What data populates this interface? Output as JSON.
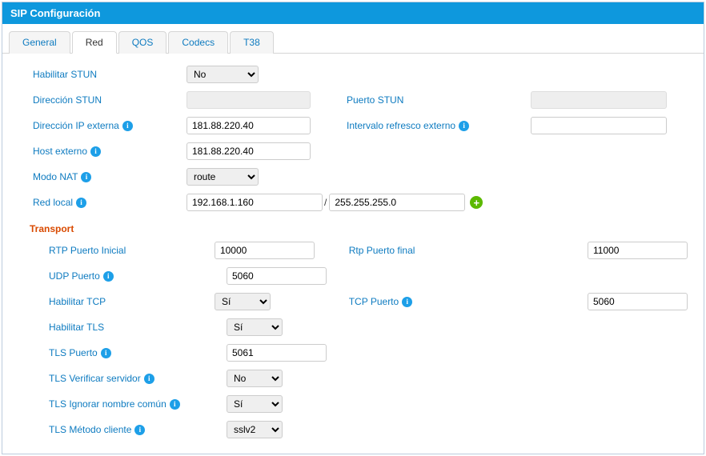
{
  "panel": {
    "title": "SIP Configuración"
  },
  "tabs": {
    "general": "General",
    "red": "Red",
    "qos": "QOS",
    "codecs": "Codecs",
    "t38": "T38",
    "active": "red"
  },
  "labels": {
    "habilitar_stun": "Habilitar STUN",
    "direccion_stun": "Dirección STUN",
    "puerto_stun": "Puerto STUN",
    "direccion_ip_externa": "Dirección IP externa",
    "intervalo_refresco_externo": "Intervalo refresco externo",
    "host_externo": "Host externo",
    "modo_nat": "Modo NAT",
    "red_local": "Red local",
    "transport": "Transport",
    "rtp_puerto_inicial": "RTP Puerto Inicial",
    "rtp_puerto_final": "Rtp Puerto final",
    "udp_puerto": "UDP Puerto",
    "habilitar_tcp": "Habilitar TCP",
    "tcp_puerto": "TCP Puerto",
    "habilitar_tls": "Habilitar TLS",
    "tls_puerto": "TLS Puerto",
    "tls_verificar_servidor": "TLS Verificar servidor",
    "tls_ignorar_nombre_comun": "TLS Ignorar nombre común",
    "tls_metodo_cliente": "TLS Método cliente"
  },
  "values": {
    "habilitar_stun": "No",
    "direccion_stun": "",
    "puerto_stun": "",
    "direccion_ip_externa": "181.88.220.40",
    "intervalo_refresco_externo": "",
    "host_externo": "181.88.220.40",
    "modo_nat": "route",
    "red_local_ip": "192.168.1.160",
    "red_local_mask": "255.255.255.0",
    "rtp_puerto_inicial": "10000",
    "rtp_puerto_final": "11000",
    "udp_puerto": "5060",
    "habilitar_tcp": "Sí",
    "tcp_puerto": "5060",
    "habilitar_tls": "Sí",
    "tls_puerto": "5061",
    "tls_verificar_servidor": "No",
    "tls_ignorar_nombre_comun": "Sí",
    "tls_metodo_cliente": "sslv2"
  },
  "options": {
    "si_no": [
      "Sí",
      "No"
    ],
    "no_si": [
      "No",
      "Sí"
    ],
    "modo_nat": [
      "route"
    ],
    "tls_metodo": [
      "sslv2"
    ]
  }
}
